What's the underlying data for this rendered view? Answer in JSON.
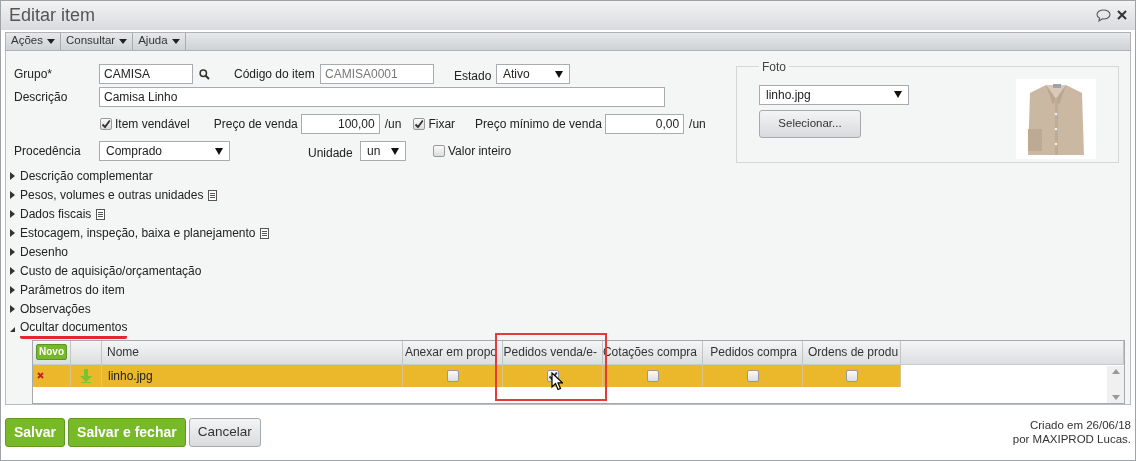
{
  "window": {
    "title": "Editar item"
  },
  "menu": [
    {
      "label": "Ações"
    },
    {
      "label": "Consultar"
    },
    {
      "label": "Ajuda"
    }
  ],
  "form": {
    "group_label": "Grupo*",
    "group_value": "CAMISA",
    "code_label": "Código do item",
    "code_value": "CAMISA0001",
    "state_label": "Estado",
    "state_value": "Ativo",
    "description_label": "Descrição",
    "description_value": "Camisa Linho",
    "saleable": {
      "label": "Item vendável",
      "checked": true
    },
    "price_label": "Preço de venda",
    "price_value": "100,00",
    "price_unit": "/un",
    "fixed": {
      "label": "Fixar",
      "checked": true
    },
    "min_price_label": "Preço mínimo de venda",
    "min_price_value": "0,00",
    "min_price_unit": "/un",
    "origin_label": "Procedência",
    "origin_value": "Comprado",
    "unit_label": "Unidade",
    "unit_value": "un",
    "integer_value": {
      "label": "Valor inteiro",
      "checked": false
    }
  },
  "photo": {
    "legend": "Foto",
    "file": "linho.jpg",
    "select_button": "Selecionar..."
  },
  "sections": [
    {
      "label": "Descrição complementar",
      "expanded": false,
      "doc_icon": false,
      "highlighted": false
    },
    {
      "label": "Pesos, volumes e outras unidades",
      "expanded": false,
      "doc_icon": true,
      "highlighted": false
    },
    {
      "label": "Dados fiscais",
      "expanded": false,
      "doc_icon": true,
      "highlighted": false
    },
    {
      "label": "Estocagem, inspeção, baixa e planejamento",
      "expanded": false,
      "doc_icon": true,
      "highlighted": false
    },
    {
      "label": "Desenho",
      "expanded": false,
      "doc_icon": false,
      "highlighted": false
    },
    {
      "label": "Custo de aquisição/orçamentação",
      "expanded": false,
      "doc_icon": false,
      "highlighted": false
    },
    {
      "label": "Parâmetros do item",
      "expanded": false,
      "doc_icon": false,
      "highlighted": false
    },
    {
      "label": "Observações",
      "expanded": false,
      "doc_icon": false,
      "highlighted": false
    },
    {
      "label": "Ocultar documentos",
      "expanded": true,
      "doc_icon": false,
      "highlighted": true
    }
  ],
  "documents": {
    "new_button": "Novo",
    "columns": [
      {
        "label": "Nome",
        "highlighted": false
      },
      {
        "label": "Anexar em propo",
        "highlighted": false
      },
      {
        "label": "Pedidos venda/e-",
        "highlighted": true
      },
      {
        "label": "Cotações compra",
        "highlighted": false
      },
      {
        "label": "Pedidos compra",
        "highlighted": false
      },
      {
        "label": "Ordens de produ",
        "highlighted": false
      }
    ],
    "rows": [
      {
        "name": "linho.jpg",
        "selected": true,
        "checks": [
          false,
          true,
          false,
          false,
          false
        ]
      }
    ]
  },
  "buttons": [
    {
      "label": "Salvar",
      "kind": "primary"
    },
    {
      "label": "Salvar e fechar",
      "kind": "primary"
    },
    {
      "label": "Cancelar",
      "kind": "secondary"
    }
  ],
  "footer": [
    "Criado em 26/06/18",
    "por MAXIPROD Lucas."
  ]
}
